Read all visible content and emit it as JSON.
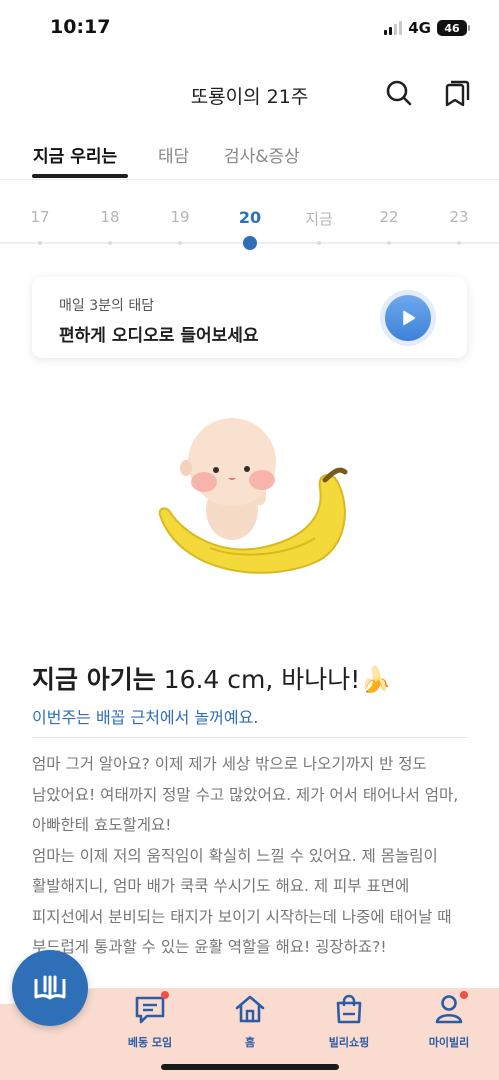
{
  "status_bar": {
    "time": "10:17",
    "network": "4G",
    "battery": "46"
  },
  "header": {
    "title": "또룡이의 21주",
    "search_icon": "search-icon",
    "bookmark_icon": "bookmarks-icon"
  },
  "tabs": [
    {
      "label": "지금 우리는",
      "active": true
    },
    {
      "label": "태담",
      "active": false
    },
    {
      "label": "검사&증상",
      "active": false
    }
  ],
  "weeks": {
    "items": [
      "17",
      "18",
      "19",
      "20",
      "지금",
      "22",
      "23"
    ],
    "selected": "20"
  },
  "audio_card": {
    "subtitle": "매일 3분의 태담",
    "title": "편하게 오디오로 들어보세요",
    "play_icon": "play-icon"
  },
  "baby": {
    "heading_bold": "지금 아기는",
    "heading_rest": "16.4 cm, 바나나!🍌",
    "subheading": "이번주는 배꼽 근처에서 놀꺼예요.",
    "letter": "엄마 그거 알아요? 이제 제가 세상 밖으로 나오기까지 반 정도 남았어요! 여태까지 정말 수고 많았어요. 제가 어서 태어나서 엄마,아빠한테 효도할게요!\n엄마는 이제 저의 움직임이 확실히 느낄 수 있어요. 제 몸놀림이 활발해지니, 엄마 배가 쿡쿡 쑤시기도 해요. 제 피부 표면에 피지선에서 분비되는 태지가 보이기 시작하는데 나중에 태어날 때 부드럽게 통과할 수 있는 윤활 역할을 해요! 굉장하죠?!"
  },
  "bottom_nav": {
    "items": [
      {
        "label": "베동 모임",
        "icon": "chat-icon",
        "badge": true
      },
      {
        "label": "홈",
        "icon": "home-icon",
        "badge": false
      },
      {
        "label": "빌리쇼핑",
        "icon": "shopping-bag-icon",
        "badge": false
      },
      {
        "label": "마이빌리",
        "icon": "person-icon",
        "badge": true
      }
    ],
    "fab_icon": "book-icon"
  },
  "colors": {
    "accent": "#2f6fb7",
    "nav_bg": "#f9dccf",
    "badge": "#f0504a"
  }
}
